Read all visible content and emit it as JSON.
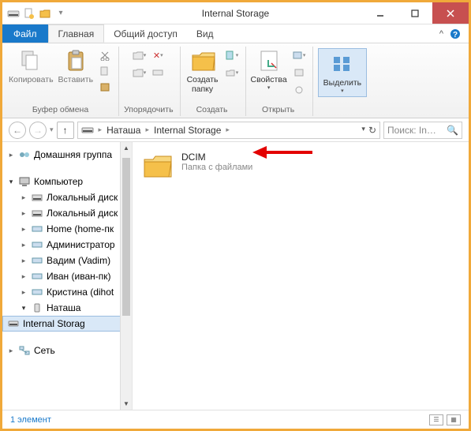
{
  "window": {
    "title": "Internal Storage"
  },
  "tabs": {
    "file": "Файл",
    "home": "Главная",
    "share": "Общий доступ",
    "view": "Вид"
  },
  "ribbon": {
    "copy": "Копировать",
    "paste": "Вставить",
    "clipboard_grp": "Буфер обмена",
    "organize_grp": "Упорядочить",
    "new_folder": "Создать\nпапку",
    "new_grp": "Создать",
    "properties": "Свойства",
    "open_grp": "Открыть",
    "select": "Выделить",
    "select_grp": ""
  },
  "breadcrumbs": [
    "Наташа",
    "Internal Storage"
  ],
  "search": {
    "placeholder": "Поиск: In…"
  },
  "tree": {
    "homegroup": "Домашняя группа",
    "computer": "Компьютер",
    "items": [
      "Локальный диск",
      "Локальный диск",
      "Home (home-пк",
      "Администратор",
      "Вадим (Vadim)",
      "Иван (иван-пк)",
      "Кристина (dihot",
      "Наташа"
    ],
    "selected": "Internal Storag",
    "network": "Сеть"
  },
  "content": {
    "folder_name": "DCIM",
    "folder_desc": "Папка с файлами"
  },
  "status": {
    "count": "1 элемент"
  }
}
